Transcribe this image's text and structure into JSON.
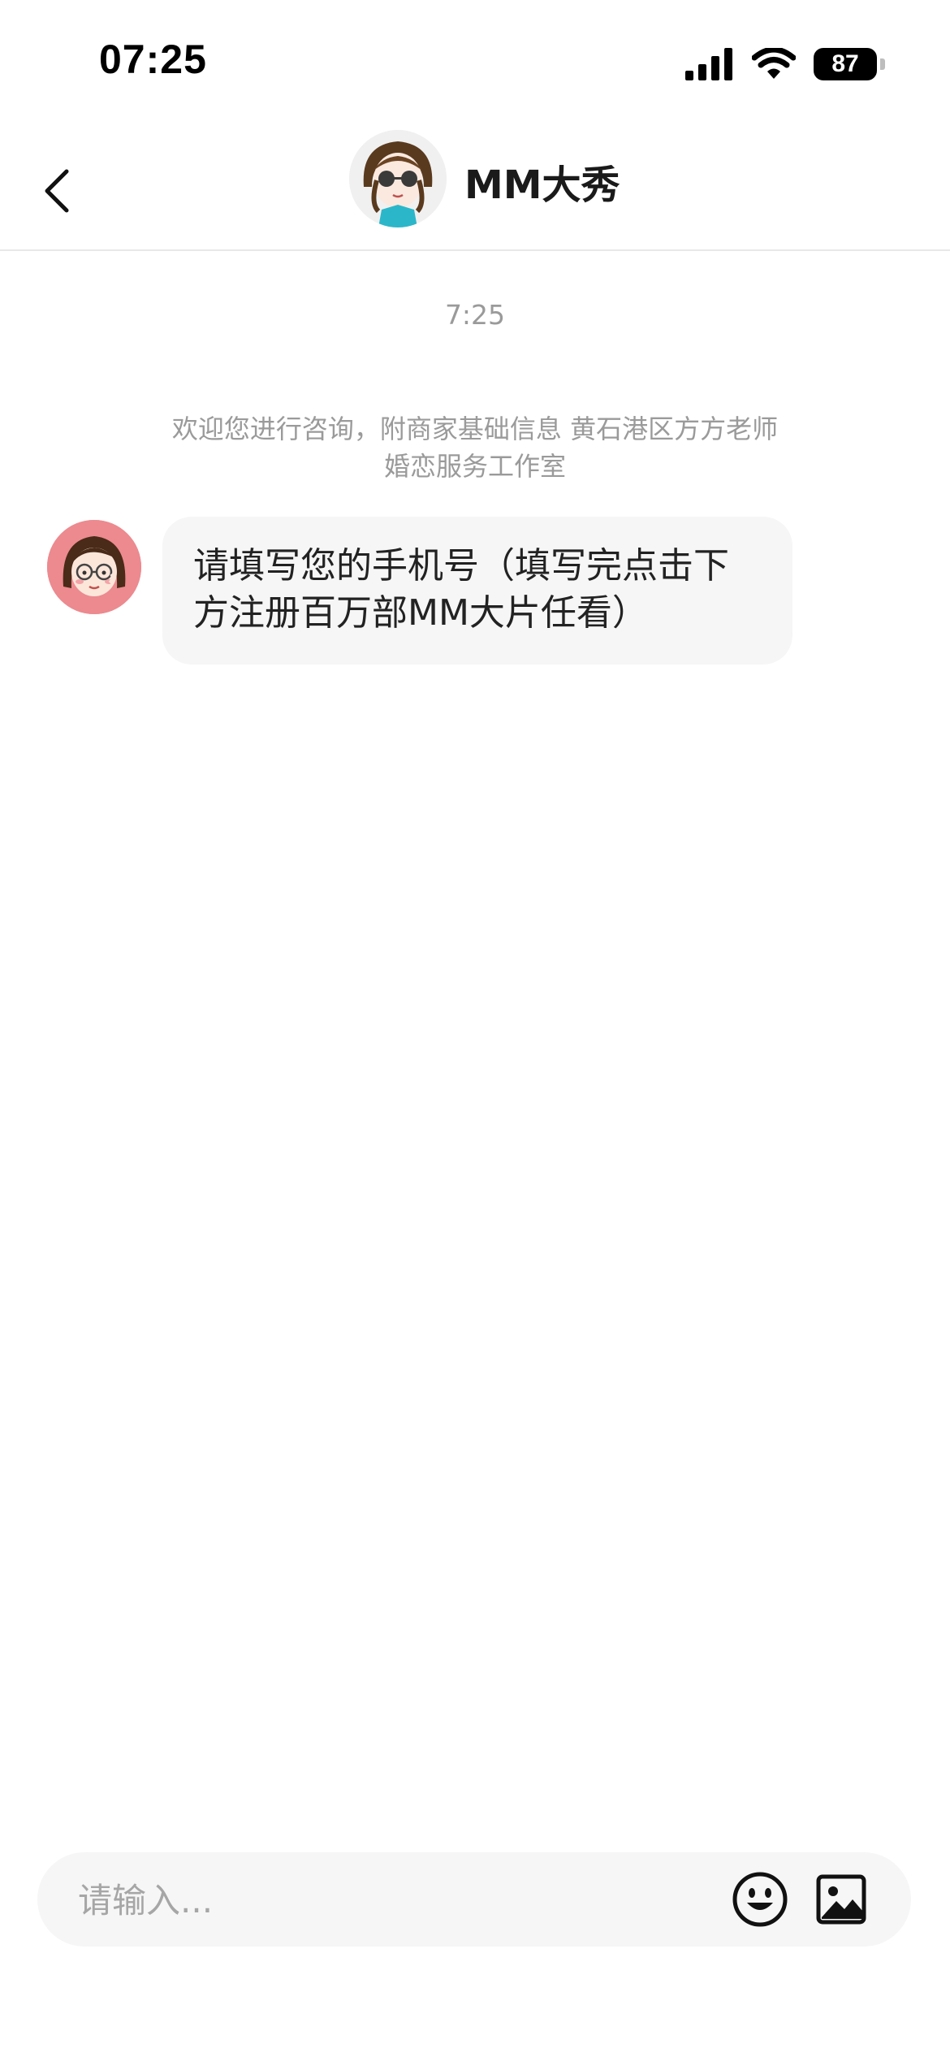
{
  "status_bar": {
    "time": "07:25",
    "battery_level": "87"
  },
  "header": {
    "title": "MM大秀",
    "avatar_icon": "cartoon-girl-sunglasses-icon",
    "back_icon": "chevron-left-icon"
  },
  "chat": {
    "timestamp": "7:25",
    "system_notice": "欢迎您进行咨询，附商家基础信息 黄石港区方方老师婚恋服务工作室",
    "messages": [
      {
        "sender_avatar_icon": "cartoon-girl-glasses-icon",
        "text": "请填写您的手机号（填写完点击下方注册百万部MM大片任看）"
      }
    ]
  },
  "input_bar": {
    "placeholder": "请输入...",
    "emoji_icon": "smiley-icon",
    "image_icon": "image-icon"
  }
}
